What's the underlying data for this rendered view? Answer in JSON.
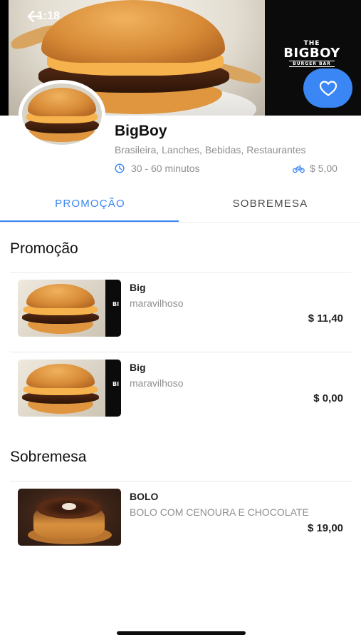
{
  "status_bar": {
    "time": "1:18"
  },
  "header": {
    "back_icon": "arrow-left-icon",
    "brand_logo": {
      "line1": "THE",
      "line2": "BIGBOY",
      "line3": "BURGER BAR"
    },
    "favorite_icon": "heart-icon",
    "accent": "#3a86f5"
  },
  "store": {
    "name": "BigBoy",
    "categories": "Brasileira, Lanches, Bebidas, Restaurantes",
    "delivery_time": "30 - 60 minutos",
    "delivery_fee": "$ 5,00",
    "time_icon": "clock-icon",
    "fee_icon": "bicycle-icon"
  },
  "tabs": [
    {
      "label": "PROMOÇÃO",
      "active": true
    },
    {
      "label": "SOBREMESA",
      "active": false
    }
  ],
  "sections": [
    {
      "title": "Promoção",
      "items": [
        {
          "name": "Big",
          "description": "maravilhoso",
          "price": "$ 11,40",
          "image": "burger-photo"
        },
        {
          "name": "Big",
          "description": "maravilhoso",
          "price": "$ 0,00",
          "image": "burger-photo"
        }
      ]
    },
    {
      "title": "Sobremesa",
      "items": [
        {
          "name": "BOLO",
          "description": "BOLO COM CENOURA E CHOCOLATE",
          "price": "$ 19,00",
          "image": "cake-photo"
        }
      ]
    }
  ]
}
